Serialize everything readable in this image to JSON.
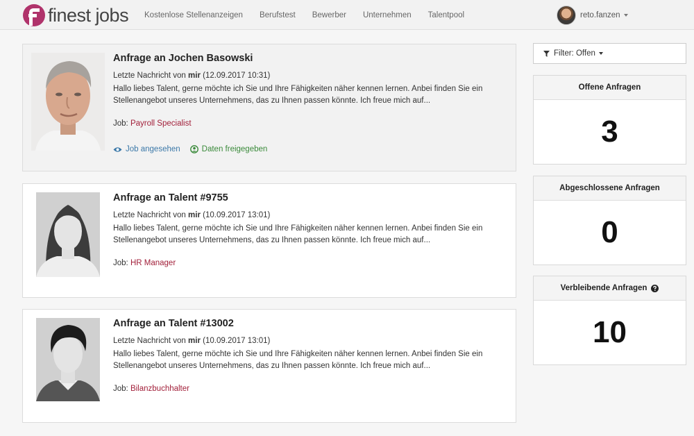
{
  "brand": {
    "logo_text": "finest jobs",
    "accent": "#b0336b"
  },
  "nav": [
    {
      "label": "Kostenlose Stellenanzeigen"
    },
    {
      "label": "Berufstest"
    },
    {
      "label": "Bewerber"
    },
    {
      "label": "Unternehmen"
    },
    {
      "label": "Talentpool"
    }
  ],
  "user": {
    "name": "reto.fanzen"
  },
  "requests": [
    {
      "title": "Anfrage an Jochen Basowski",
      "meta_prefix": "Letzte Nachricht von",
      "meta_sender": "mir",
      "meta_date": "(12.09.2017 10:31)",
      "text": "Hallo liebes Talent, gerne möchte ich Sie und Ihre Fähigkeiten näher kennen lernen. Anbei finden Sie ein Stellenangebot unseres Unternehmens, das zu Ihnen passen könnte. Ich freue mich auf...",
      "job_label": "Job:",
      "job_value": "Payroll Specialist",
      "actions": [
        {
          "label": "Job angesehen"
        },
        {
          "label": "Daten freigegeben"
        }
      ]
    },
    {
      "title": "Anfrage an Talent #9755",
      "meta_prefix": "Letzte Nachricht von",
      "meta_sender": "mir",
      "meta_date": "(10.09.2017 13:01)",
      "text": "Hallo liebes Talent, gerne möchte ich Sie und Ihre Fähigkeiten näher kennen lernen. Anbei finden Sie ein Stellenangebot unseres Unternehmens, das zu Ihnen passen könnte. Ich freue mich auf...",
      "job_label": "Job:",
      "job_value": "HR Manager"
    },
    {
      "title": "Anfrage an Talent #13002",
      "meta_prefix": "Letzte Nachricht von",
      "meta_sender": "mir",
      "meta_date": "(10.09.2017 13:01)",
      "text": "Hallo liebes Talent, gerne möchte ich Sie und Ihre Fähigkeiten näher kennen lernen. Anbei finden Sie ein Stellenangebot unseres Unternehmens, das zu Ihnen passen könnte. Ich freue mich auf...",
      "job_label": "Job:",
      "job_value": "Bilanzbuchhalter"
    }
  ],
  "sidebar": {
    "filter_label": "Filter: Offen",
    "stats": [
      {
        "label": "Offene Anfragen",
        "value": "3"
      },
      {
        "label": "Abgeschlossene Anfragen",
        "value": "0"
      },
      {
        "label": "Verbleibende Anfragen",
        "value": "10"
      }
    ]
  }
}
